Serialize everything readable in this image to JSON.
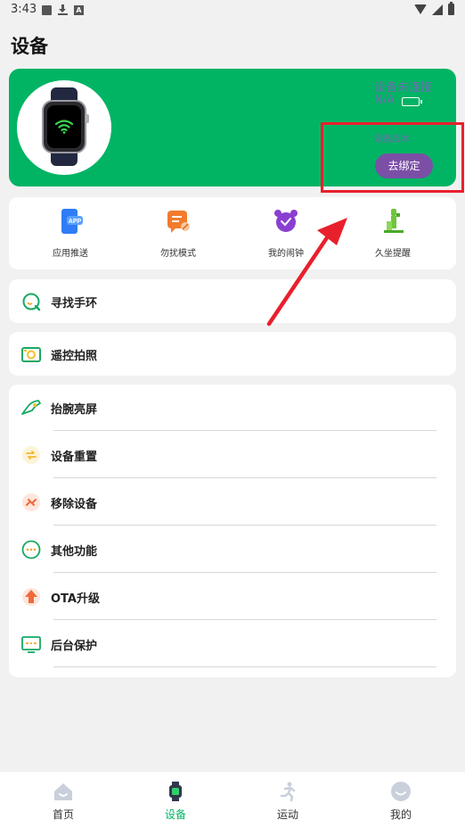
{
  "status_bar": {
    "time": "3:43",
    "notification_letter": "A"
  },
  "header": {
    "title": "设备"
  },
  "device_card": {
    "connection_status": "设备未连接",
    "battery_level": "N/A",
    "version_label": "设备版本",
    "unbind_label": "去绑定"
  },
  "quick_actions": [
    {
      "label": "应用推送",
      "icon": "app-push-icon",
      "badge": "APP"
    },
    {
      "label": "勿扰模式",
      "icon": "do-not-disturb-icon"
    },
    {
      "label": "我的闹钟",
      "icon": "alarm-clock-icon"
    },
    {
      "label": "久坐提醒",
      "icon": "sedentary-reminder-icon"
    }
  ],
  "find_band": {
    "label": "寻找手环",
    "icon": "find-band-icon"
  },
  "remote_camera": {
    "label": "遥控拍照",
    "icon": "camera-icon"
  },
  "settings": [
    {
      "label": "抬腕亮屏",
      "icon": "raise-wrist-icon"
    },
    {
      "label": "设备重置",
      "icon": "reset-icon"
    },
    {
      "label": "移除设备",
      "icon": "remove-device-icon"
    },
    {
      "label": "其他功能",
      "icon": "more-functions-icon"
    },
    {
      "label": "OTA升级",
      "icon": "ota-upgrade-icon"
    },
    {
      "label": "后台保护",
      "icon": "background-protect-icon"
    }
  ],
  "bottom_nav": [
    {
      "label": "首页",
      "icon": "home-icon",
      "active": false
    },
    {
      "label": "设备",
      "icon": "device-icon",
      "active": true
    },
    {
      "label": "运动",
      "icon": "sport-icon",
      "active": false
    },
    {
      "label": "我的",
      "icon": "profile-icon",
      "active": false
    }
  ],
  "colors": {
    "accent": "#00b464",
    "highlight": "#e8202c",
    "unbind_button": "#7b4fa6"
  }
}
